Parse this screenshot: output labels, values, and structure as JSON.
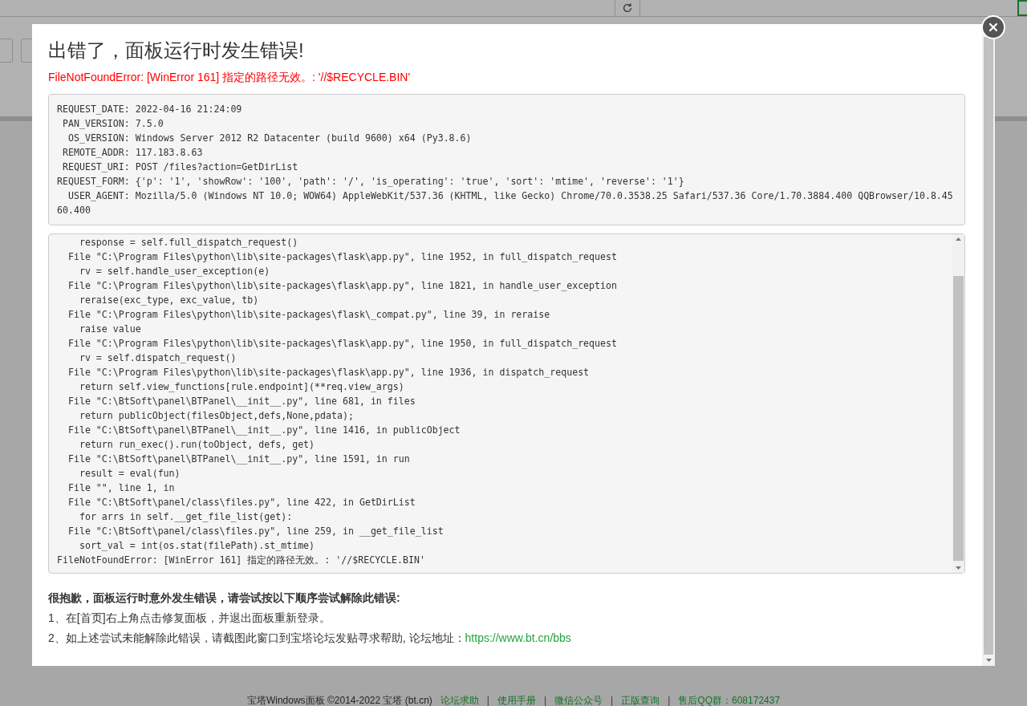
{
  "background": {
    "footer": [
      {
        "kind": "text",
        "text": "宝塔Windows面板 ©2014-2022 宝塔 (bt.cn)"
      },
      {
        "kind": "link",
        "text": "论坛求助"
      },
      {
        "kind": "sep",
        "text": "|"
      },
      {
        "kind": "link",
        "text": "使用手册"
      },
      {
        "kind": "sep",
        "text": "|"
      },
      {
        "kind": "link",
        "text": "微信公众号"
      },
      {
        "kind": "sep",
        "text": "|"
      },
      {
        "kind": "link",
        "text": "正版查询"
      },
      {
        "kind": "sep",
        "text": "|"
      },
      {
        "kind": "link",
        "text": "售后QQ群：608172437"
      }
    ]
  },
  "dialog": {
    "title": "出错了，面板运行时发生错误!",
    "error": "FileNotFoundError: [WinError 161] 指定的路径无效。: '//$RECYCLE.BIN'",
    "request_info": [
      "REQUEST_DATE: 2022-04-16 21:24:09",
      " PAN_VERSION: 7.5.0",
      "  OS_VERSION: Windows Server 2012 R2 Datacenter (build 9600) x64 (Py3.8.6)",
      " REMOTE_ADDR: 117.183.8.63",
      " REQUEST_URI: POST /files?action=GetDirList",
      "REQUEST_FORM: {'p': '1', 'showRow': '100', 'path': '/', 'is_operating': 'true', 'sort': 'mtime', 'reverse': '1'}",
      "  USER_AGENT: Mozilla/5.0 (Windows NT 10.0; WOW64) AppleWebKit/537.36 (KHTML, like Gecko) Chrome/70.0.3538.25 Safari/537.36 Core/1.70.3884.400 QQBrowser/10.8.45",
      "60.400"
    ],
    "traceback": [
      "    response = self.full_dispatch_request()",
      "  File \"C:\\Program Files\\python\\lib\\site-packages\\flask\\app.py\", line 1952, in full_dispatch_request",
      "    rv = self.handle_user_exception(e)",
      "  File \"C:\\Program Files\\python\\lib\\site-packages\\flask\\app.py\", line 1821, in handle_user_exception",
      "    reraise(exc_type, exc_value, tb)",
      "  File \"C:\\Program Files\\python\\lib\\site-packages\\flask\\_compat.py\", line 39, in reraise",
      "    raise value",
      "  File \"C:\\Program Files\\python\\lib\\site-packages\\flask\\app.py\", line 1950, in full_dispatch_request",
      "    rv = self.dispatch_request()",
      "  File \"C:\\Program Files\\python\\lib\\site-packages\\flask\\app.py\", line 1936, in dispatch_request",
      "    return self.view_functions[rule.endpoint](**req.view_args)",
      "  File \"C:\\BtSoft\\panel\\BTPanel\\__init__.py\", line 681, in files",
      "    return publicObject(filesObject,defs,None,pdata);",
      "  File \"C:\\BtSoft\\panel\\BTPanel\\__init__.py\", line 1416, in publicObject",
      "    return run_exec().run(toObject, defs, get)",
      "  File \"C:\\BtSoft\\panel\\BTPanel\\__init__.py\", line 1591, in run",
      "    result = eval(fun)",
      "  File \"\", line 1, in",
      "  File \"C:\\BtSoft\\panel/class\\files.py\", line 422, in GetDirList",
      "    for arrs in self.__get_file_list(get):",
      "  File \"C:\\BtSoft\\panel/class\\files.py\", line 259, in __get_file_list",
      "    sort_val = int(os.stat(filePath).st_mtime)",
      "FileNotFoundError: [WinError 161] 指定的路径无效。: '//$RECYCLE.BIN'"
    ],
    "help_title": "很抱歉，面板运行时意外发生错误，请尝试按以下顺序尝试解除此错误:",
    "help_steps": [
      {
        "text": "1、在[首页]右上角点击修复面板，并退出面板重新登录。"
      },
      {
        "text": "2、如上述尝试未能解除此错误，请截图此窗口到宝塔论坛发贴寻求帮助, 论坛地址：",
        "link": "https://www.bt.cn/bbs"
      }
    ]
  }
}
